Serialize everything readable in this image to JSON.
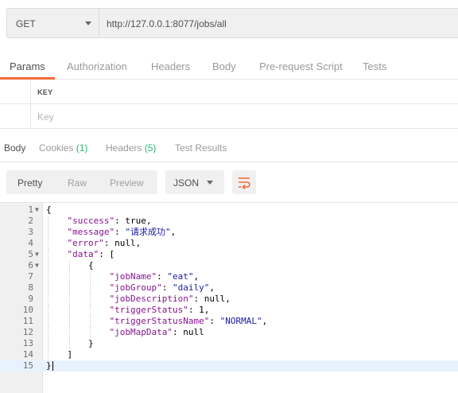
{
  "request": {
    "method": "GET",
    "url": "http://127.0.0.1:8077/jobs/all"
  },
  "request_tabs": [
    "Params",
    "Authorization",
    "Headers",
    "Body",
    "Pre-request Script",
    "Tests"
  ],
  "params_table": {
    "header": "KEY",
    "key_placeholder": "Key"
  },
  "response_tabs": {
    "body": "Body",
    "cookies": "Cookies",
    "cookies_count": "(1)",
    "headers": "Headers",
    "headers_count": "(5)",
    "test_results": "Test Results"
  },
  "view_modes": [
    "Pretty",
    "Raw",
    "Preview"
  ],
  "format": "JSON",
  "accent_color": "#f26b3a",
  "code_lines": [
    {
      "n": "1",
      "fold": true
    },
    {
      "n": "2",
      "fold": false
    },
    {
      "n": "3",
      "fold": false
    },
    {
      "n": "4",
      "fold": false
    },
    {
      "n": "5",
      "fold": true
    },
    {
      "n": "6",
      "fold": true
    },
    {
      "n": "7",
      "fold": false
    },
    {
      "n": "8",
      "fold": false
    },
    {
      "n": "9",
      "fold": false
    },
    {
      "n": "10",
      "fold": false
    },
    {
      "n": "11",
      "fold": false
    },
    {
      "n": "12",
      "fold": false
    },
    {
      "n": "13",
      "fold": false
    },
    {
      "n": "14",
      "fold": false
    },
    {
      "n": "15",
      "fold": false
    }
  ],
  "json_response": {
    "success": "true",
    "message": "请求成功",
    "error": "null",
    "job": {
      "jobName": "eat",
      "jobGroup": "daily",
      "jobDescription": "null",
      "triggerStatus": "1",
      "triggerStatusName": "NORMAL",
      "jobMapData": "null"
    }
  }
}
